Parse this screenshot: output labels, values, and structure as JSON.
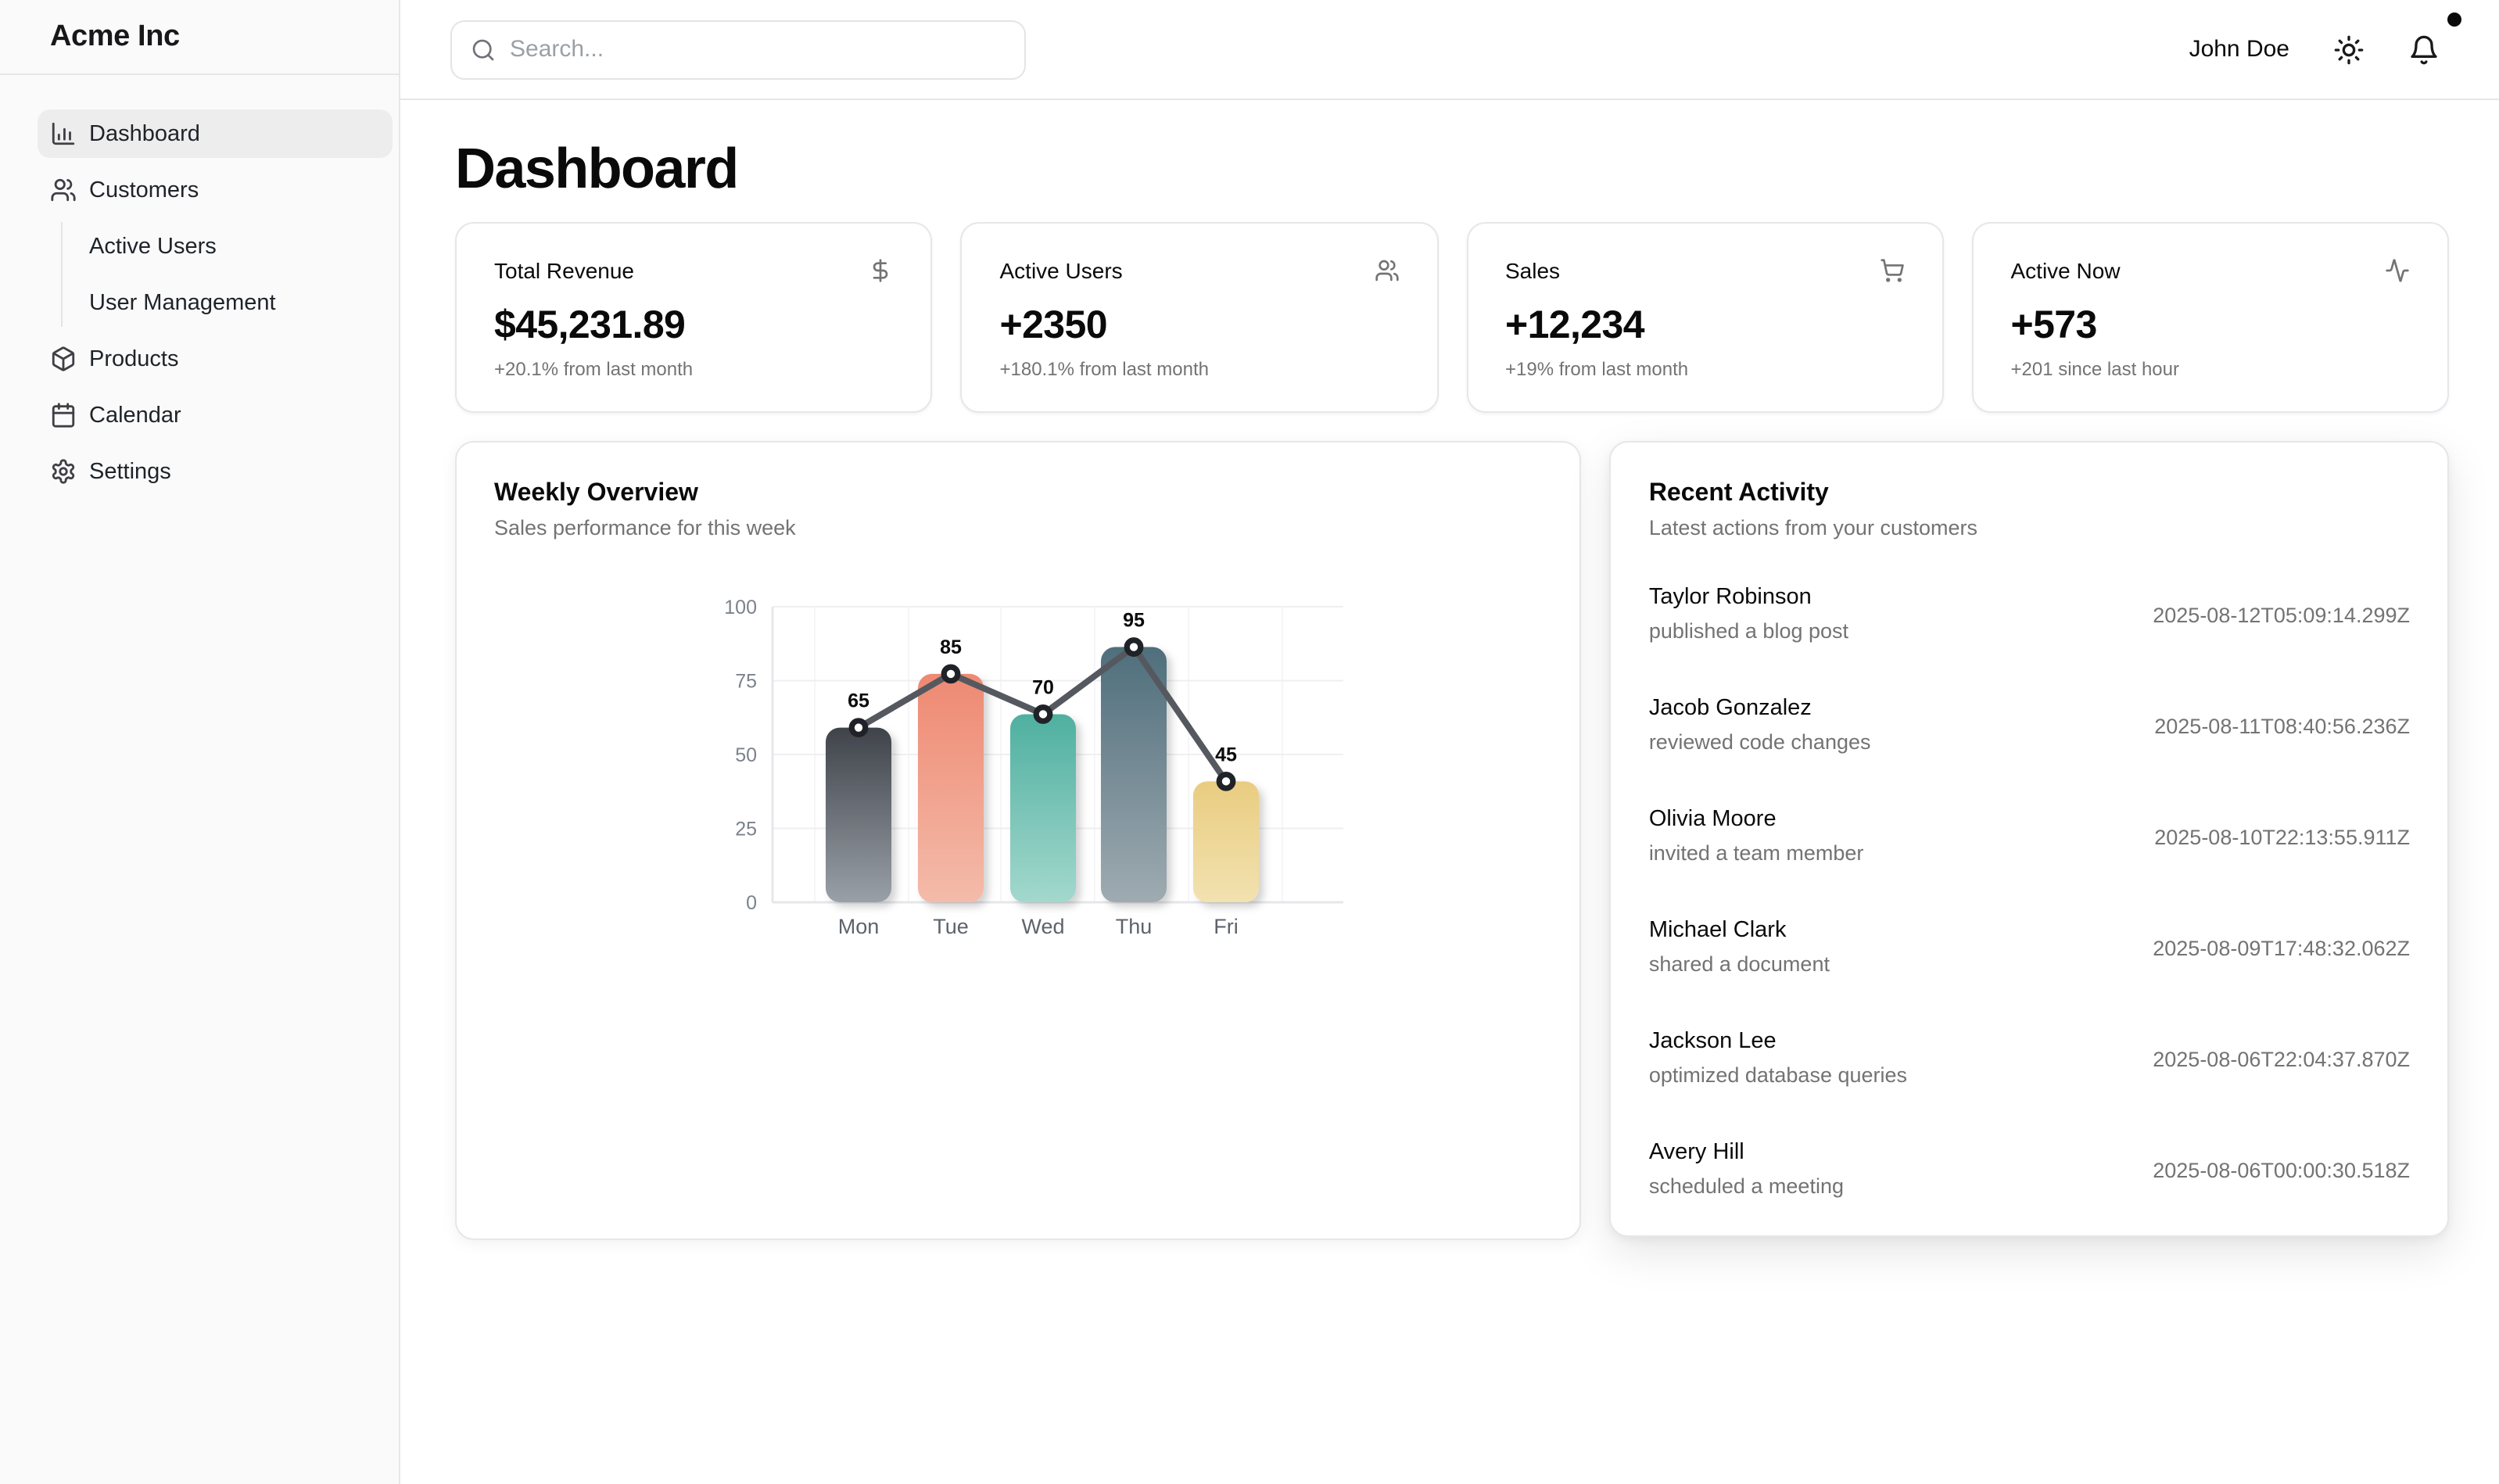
{
  "brand": "Acme Inc",
  "topbar": {
    "search": {
      "placeholder": "Search...",
      "value": "",
      "icon": "search-icon"
    },
    "user_name": "John Doe",
    "theme_icon": "sun-icon",
    "bell_icon": "bell-icon",
    "notification_dot_color": "#0a0a0a"
  },
  "sidebar": {
    "items": [
      {
        "label": "Dashboard",
        "icon": "bar-chart-icon",
        "active": true
      },
      {
        "label": "Customers",
        "icon": "users-icon",
        "active": false,
        "children": [
          {
            "label": "Active Users"
          },
          {
            "label": "User Management"
          }
        ]
      },
      {
        "label": "Products",
        "icon": "package-icon",
        "active": false
      },
      {
        "label": "Calendar",
        "icon": "calendar-icon",
        "active": false
      },
      {
        "label": "Settings",
        "icon": "gear-icon",
        "active": false
      }
    ]
  },
  "page": {
    "title": "Dashboard"
  },
  "stats": [
    {
      "title": "Total Revenue",
      "icon": "dollar-sign-icon",
      "value": "$45,231.89",
      "change": "+20.1% from last month"
    },
    {
      "title": "Active Users",
      "icon": "users-icon",
      "value": "+2350",
      "change": "+180.1% from last month"
    },
    {
      "title": "Sales",
      "icon": "shopping-cart-icon",
      "value": "+12,234",
      "change": "+19% from last month"
    },
    {
      "title": "Active Now",
      "icon": "activity-icon",
      "value": "+573",
      "change": "+201 since last hour"
    }
  ],
  "weekly": {
    "title": "Weekly Overview",
    "subtitle": "Sales performance for this week"
  },
  "chart_data": {
    "type": "bar",
    "title": "Weekly Overview",
    "subtitle": "Sales performance for this week",
    "categories": [
      "Mon",
      "Tue",
      "Wed",
      "Thu",
      "Fri"
    ],
    "series": [
      {
        "name": "sales-bars",
        "type": "bar",
        "values": [
          65,
          85,
          70,
          95,
          45
        ]
      },
      {
        "name": "sales-line",
        "type": "line",
        "values": [
          65,
          85,
          70,
          95,
          45
        ]
      }
    ],
    "show_data_labels": true,
    "yticks": [
      0,
      25,
      50,
      75,
      100
    ],
    "ylim": [
      0,
      100
    ],
    "bar_display_scale_max": 110,
    "grid": true,
    "legend": false,
    "bar_gradients": [
      [
        "#3f434a",
        "#9aa0a8"
      ],
      [
        "#ee8972",
        "#f4bbaa"
      ],
      [
        "#4fb0a0",
        "#a3d8cd"
      ],
      [
        "#4f6e7c",
        "#9fabb1"
      ],
      [
        "#e9cc80",
        "#f2e2b0"
      ]
    ],
    "line_color": "#55595f",
    "marker": {
      "fill": "#ffffff",
      "stroke": "#1f2227"
    },
    "label_color": "#0a0a0a",
    "tick_color": "#7b828c",
    "day_label_color": "#5d636c",
    "grid_color": "#efeff2",
    "axis_color": "#e6e7ea"
  },
  "activity": {
    "title": "Recent Activity",
    "subtitle": "Latest actions from your customers",
    "items": [
      {
        "name": "Taylor Robinson",
        "action": "published a blog post",
        "timestamp": "2025-08-12T05:09:14.299Z"
      },
      {
        "name": "Jacob Gonzalez",
        "action": "reviewed code changes",
        "timestamp": "2025-08-11T08:40:56.236Z"
      },
      {
        "name": "Olivia Moore",
        "action": "invited a team member",
        "timestamp": "2025-08-10T22:13:55.911Z"
      },
      {
        "name": "Michael Clark",
        "action": "shared a document",
        "timestamp": "2025-08-09T17:48:32.062Z"
      },
      {
        "name": "Jackson Lee",
        "action": "optimized database queries",
        "timestamp": "2025-08-06T22:04:37.870Z"
      },
      {
        "name": "Avery Hill",
        "action": "scheduled a meeting",
        "timestamp": "2025-08-06T00:00:30.518Z"
      }
    ]
  }
}
